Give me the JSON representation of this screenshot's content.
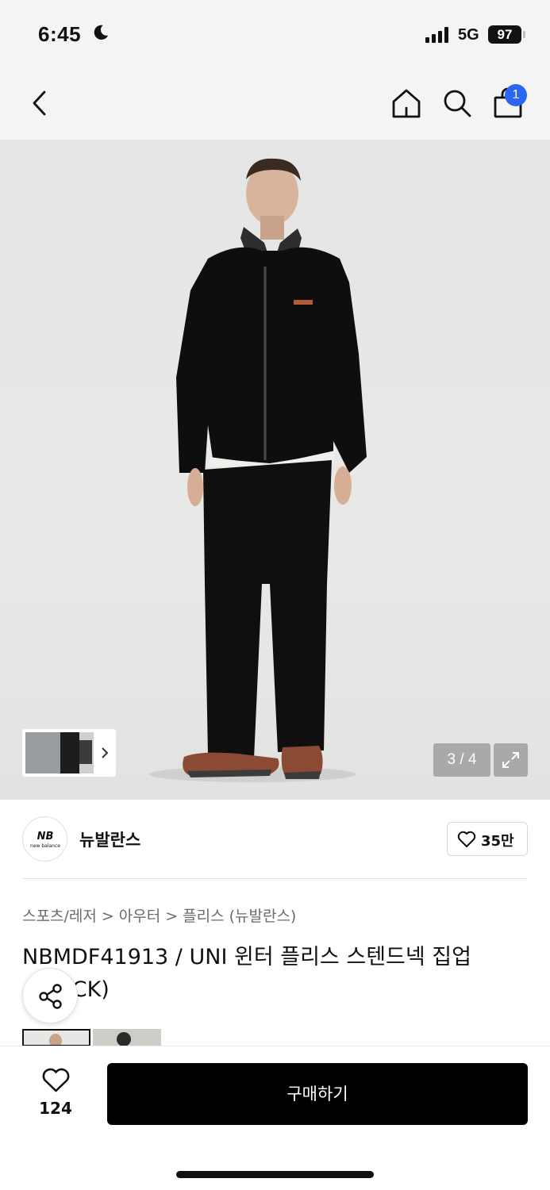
{
  "status_bar": {
    "time": "6:45",
    "network": "5G",
    "battery": "97",
    "icons": [
      "moon-icon",
      "signal-icon",
      "battery-icon"
    ]
  },
  "nav": {
    "icons": [
      "back-icon",
      "home-icon",
      "search-icon",
      "cart-icon"
    ],
    "cart_badge": "1",
    "badge_color": "#2a66f0"
  },
  "gallery": {
    "counter": "3 / 4",
    "current_index": 3,
    "total": 4,
    "expand_icon": "expand-icon"
  },
  "brand": {
    "name": "뉴발란스",
    "logo_text": "new balance",
    "like_count": "35만"
  },
  "breadcrumb": {
    "items": [
      "스포츠/레저",
      "아우터",
      "플리스 (뉴발란스)"
    ],
    "separator": ">"
  },
  "product": {
    "title": "NBMDF41913 / UNI 윈터 플리스 스텐드넥 집업 (BLACK)"
  },
  "bottom_bar": {
    "wish_count": "124",
    "buy_label": "구매하기",
    "buy_color": "#000000"
  }
}
